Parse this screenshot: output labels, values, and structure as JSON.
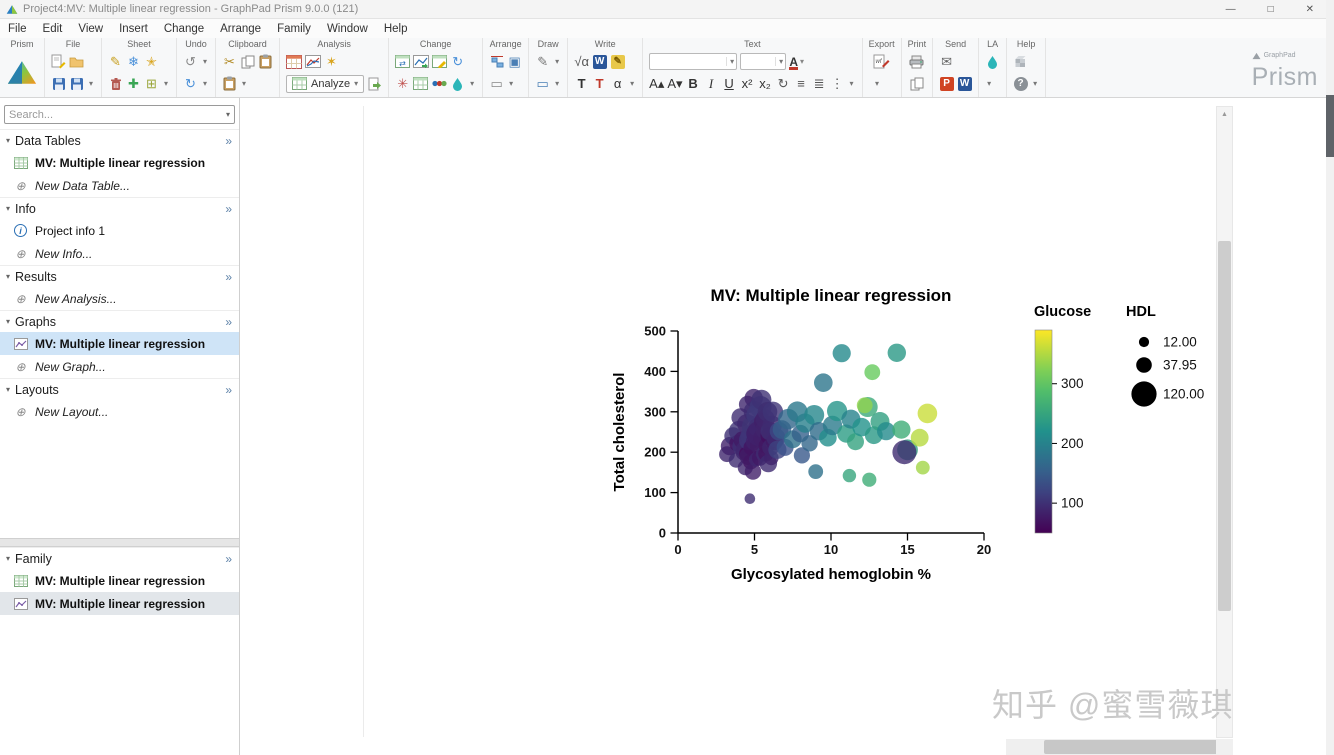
{
  "window": {
    "title": "Project4:MV: Multiple linear regression - GraphPad Prism 9.0.0 (121)",
    "controls": {
      "minimize": "—",
      "maximize": "□",
      "close": "✕"
    }
  },
  "menu": {
    "items": [
      "File",
      "Edit",
      "View",
      "Insert",
      "Change",
      "Arrange",
      "Family",
      "Window",
      "Help"
    ]
  },
  "toolbar": {
    "brand": {
      "name": "Prism",
      "sub": "GraphPad"
    },
    "groups": [
      {
        "label": "Prism",
        "name": "prism",
        "rows": [
          [
            {
              "n": "prism-logo-icon",
              "k": "prism"
            }
          ]
        ]
      },
      {
        "label": "File",
        "name": "file",
        "rows": [
          [
            {
              "n": "new-file-icon",
              "k": "docpencil"
            },
            {
              "n": "open-file-icon",
              "k": "folder"
            }
          ],
          [
            {
              "n": "save-icon",
              "k": "disk"
            },
            {
              "n": "save-as-icon",
              "k": "disk"
            },
            {
              "n": "file-menu-icon",
              "g": "▾"
            }
          ]
        ]
      },
      {
        "label": "Sheet",
        "name": "sheet",
        "rows": [
          [
            {
              "n": "rename-sheet-icon",
              "g": "✎",
              "c": "#c8a020"
            },
            {
              "n": "freeze-sheet-icon",
              "g": "❄",
              "c": "#4a90d9"
            },
            {
              "n": "star-sheet-icon",
              "g": "✭",
              "c": "#d9a520"
            }
          ],
          [
            {
              "n": "delete-sheet-icon",
              "k": "trash"
            },
            {
              "n": "new-sheet-icon",
              "g": "✚",
              "c": "#3aa655"
            },
            {
              "n": "exclude-sheet-icon",
              "g": "⊞",
              "c": "#9aa63a"
            },
            {
              "n": "sheet-menu-icon",
              "g": "▾"
            }
          ]
        ]
      },
      {
        "label": "Undo",
        "name": "undo",
        "rows": [
          [
            {
              "n": "undo-icon",
              "g": "↺",
              "c": "#8a8a8a"
            },
            {
              "n": "undo-menu-icon",
              "g": "▾"
            }
          ],
          [
            {
              "n": "redo-icon",
              "g": "↻",
              "c": "#4a90d9"
            },
            {
              "n": "redo-menu-icon",
              "g": "▾"
            }
          ]
        ]
      },
      {
        "label": "Clipboard",
        "name": "clipboard",
        "rows": [
          [
            {
              "n": "cut-icon",
              "g": "✂",
              "c": "#b08820"
            },
            {
              "n": "copy-icon",
              "k": "copy"
            },
            {
              "n": "paste-icon",
              "k": "clipboard"
            }
          ],
          [
            {
              "n": "paste-special-icon",
              "k": "clipboard"
            },
            {
              "n": "clipboard-menu-icon",
              "g": "▾"
            }
          ]
        ]
      },
      {
        "label": "Analysis",
        "name": "analysis",
        "rows": [
          [
            {
              "n": "new-analysis-table-icon",
              "k": "tableOrange"
            },
            {
              "n": "xy-analysis-icon",
              "k": "chart"
            },
            {
              "n": "wand-icon",
              "g": "✶",
              "c": "#d9a520"
            }
          ],
          [
            {
              "n": "analyze-button",
              "k": "analyze",
              "label": "Analyze"
            },
            {
              "n": "apply-analysis-icon",
              "k": "docarrow"
            }
          ]
        ]
      },
      {
        "label": "Change",
        "name": "change",
        "rows": [
          [
            {
              "n": "swap-rows-icon",
              "k": "tableSwap"
            },
            {
              "n": "change-graph-type-icon",
              "k": "chartChange"
            },
            {
              "n": "edit-table-icon",
              "k": "tablePencil"
            },
            {
              "n": "update-icon",
              "g": "↻",
              "c": "#4a90d9"
            }
          ],
          [
            {
              "n": "interpolate-icon",
              "g": "✳",
              "c": "#c0504d"
            },
            {
              "n": "transpose-icon",
              "k": "tableGreen"
            },
            {
              "n": "symbols-icon",
              "k": "dots"
            },
            {
              "n": "color-scheme-icon",
              "k": "paint"
            },
            {
              "n": "change-menu-icon",
              "g": "▾"
            }
          ]
        ]
      },
      {
        "label": "Arrange",
        "name": "arrange",
        "rows": [
          [
            {
              "n": "align-objects-icon",
              "k": "align"
            },
            {
              "n": "group-objects-icon",
              "g": "▣",
              "c": "#4a7fb5"
            }
          ],
          [
            {
              "n": "send-back-icon",
              "g": "▭",
              "c": "#888"
            },
            {
              "n": "arrange-menu-icon",
              "g": "▾"
            }
          ]
        ]
      },
      {
        "label": "Draw",
        "name": "draw",
        "rows": [
          [
            {
              "n": "draw-tool-icon",
              "g": "✎",
              "c": "#777"
            },
            {
              "n": "draw-menu-icon",
              "g": "▾"
            }
          ],
          [
            {
              "n": "shape-tool-icon",
              "g": "▭",
              "c": "#4a7fb5"
            },
            {
              "n": "shape-menu-icon",
              "g": "▾"
            }
          ]
        ]
      },
      {
        "label": "Write",
        "name": "write",
        "rows": [
          [
            {
              "n": "equation-icon",
              "g": "√α",
              "c": "#555"
            },
            {
              "n": "word-export-icon",
              "k": "word"
            },
            {
              "n": "note-icon",
              "k": "note"
            }
          ],
          [
            {
              "n": "text-tool-icon",
              "g": "T",
              "c": "#333",
              "cls": "b"
            },
            {
              "n": "text-box-icon",
              "g": "T",
              "c": "#c0392b",
              "cls": "b"
            },
            {
              "n": "greek-icon",
              "g": "α",
              "c": "#333"
            },
            {
              "n": "write-menu-icon",
              "g": "▾"
            }
          ]
        ]
      },
      {
        "label": "Text",
        "name": "text",
        "rows": [
          [
            {
              "n": "font-family-select",
              "k": "combo",
              "w": 88
            },
            {
              "n": "font-size-select",
              "k": "combo",
              "w": 46
            },
            {
              "n": "font-color-button",
              "k": "colorA"
            }
          ],
          [
            {
              "n": "increase-font-button",
              "g": "A▴",
              "c": "#333"
            },
            {
              "n": "decrease-font-button",
              "g": "A▾",
              "c": "#333"
            },
            {
              "n": "bold-button",
              "g": "B",
              "c": "#333",
              "cls": "b"
            },
            {
              "n": "italic-button",
              "g": "I",
              "c": "#333",
              "cls": "i"
            },
            {
              "n": "underline-button",
              "g": "U",
              "c": "#333",
              "cls": "u"
            },
            {
              "n": "superscript-button",
              "g": "x²",
              "c": "#333"
            },
            {
              "n": "subscript-button",
              "g": "x₂",
              "c": "#333"
            },
            {
              "n": "rotate-text-button",
              "g": "↻",
              "c": "#555"
            },
            {
              "n": "align-text-button",
              "g": "≡",
              "c": "#555"
            },
            {
              "n": "line-spacing-button",
              "g": "≣",
              "c": "#555"
            },
            {
              "n": "list-button",
              "g": "⋮",
              "c": "#555"
            },
            {
              "n": "text-menu-icon",
              "g": "▾"
            }
          ]
        ]
      },
      {
        "label": "Export",
        "name": "export",
        "rows": [
          [
            {
              "n": "export-icon",
              "k": "export"
            }
          ],
          [
            {
              "n": "export-menu-icon",
              "g": "▾"
            }
          ]
        ]
      },
      {
        "label": "Print",
        "name": "print",
        "rows": [
          [
            {
              "n": "print-icon",
              "k": "printer"
            }
          ],
          [
            {
              "n": "copy-graph-icon",
              "k": "copy"
            }
          ]
        ]
      },
      {
        "label": "Send",
        "name": "send",
        "rows": [
          [
            {
              "n": "email-icon",
              "g": "✉",
              "c": "#666"
            }
          ],
          [
            {
              "n": "powerpoint-icon",
              "k": "ppt"
            },
            {
              "n": "word-icon",
              "k": "word"
            }
          ]
        ]
      },
      {
        "label": "LA",
        "name": "la",
        "rows": [
          [
            {
              "n": "labarchives-icon",
              "k": "paint"
            }
          ],
          [
            {
              "n": "la-menu-icon",
              "g": "▾"
            }
          ]
        ]
      },
      {
        "label": "Help",
        "name": "help",
        "rows": [
          [
            {
              "n": "prism-academy-icon",
              "k": "cube"
            }
          ],
          [
            {
              "n": "help-icon",
              "k": "help"
            },
            {
              "n": "help-menu-icon",
              "g": "▾"
            }
          ]
        ]
      }
    ]
  },
  "sidebar": {
    "search": {
      "placeholder": "Search..."
    },
    "sections": [
      {
        "label": "Data Tables",
        "items": [
          {
            "label": "MV: Multiple linear regression",
            "icon": "table",
            "bold": true
          },
          {
            "label": "New Data Table...",
            "icon": "plus",
            "italic": true
          }
        ]
      },
      {
        "label": "Info",
        "items": [
          {
            "label": "Project info 1",
            "icon": "info"
          },
          {
            "label": "New Info...",
            "icon": "plus",
            "italic": true
          }
        ]
      },
      {
        "label": "Results",
        "items": [
          {
            "label": "New Analysis...",
            "icon": "plus",
            "italic": true
          }
        ]
      },
      {
        "label": "Graphs",
        "items": [
          {
            "label": "MV: Multiple linear regression",
            "icon": "graph",
            "bold": true,
            "selected": true
          },
          {
            "label": "New Graph...",
            "icon": "plus",
            "italic": true
          }
        ]
      },
      {
        "label": "Layouts",
        "items": [
          {
            "label": "New Layout...",
            "icon": "plus",
            "italic": true
          }
        ]
      }
    ],
    "family": {
      "label": "Family",
      "items": [
        {
          "label": "MV: Multiple linear regression",
          "icon": "table",
          "bold": true
        },
        {
          "label": "MV: Multiple linear regression",
          "icon": "graph",
          "bold": true,
          "selected2": true
        }
      ]
    }
  },
  "chart_data": {
    "type": "bubble",
    "title": "MV: Multiple linear regression",
    "xlabel": "Glycosylated hemoglobin %",
    "ylabel": "Total cholesterol",
    "xlim": [
      0,
      20
    ],
    "ylim": [
      0,
      500
    ],
    "x_ticks": [
      0,
      5,
      10,
      15,
      20
    ],
    "y_ticks": [
      0,
      100,
      200,
      300,
      400,
      500
    ],
    "colorbar": {
      "title": "Glucose",
      "ticks": [
        100,
        200,
        300
      ],
      "range": [
        50,
        390
      ],
      "colormap": "viridis"
    },
    "size_legend": {
      "title": "HDL",
      "entries": [
        {
          "value": "12.00",
          "hdl": 12
        },
        {
          "value": "37.95",
          "hdl": 37.95
        },
        {
          "value": "120.00",
          "hdl": 120
        }
      ]
    },
    "points_format": [
      "glycosylated_hemoglobin_x",
      "total_cholesterol_y",
      "glucose_color",
      "hdl_size"
    ],
    "points": [
      [
        3.2,
        195,
        90,
        40
      ],
      [
        3.4,
        215,
        84,
        58
      ],
      [
        3.6,
        240,
        100,
        52
      ],
      [
        3.8,
        180,
        95,
        34
      ],
      [
        3.9,
        222,
        70,
        46
      ],
      [
        4.0,
        252,
        102,
        78
      ],
      [
        4.1,
        286,
        96,
        60
      ],
      [
        4.15,
        214,
        99,
        58
      ],
      [
        4.2,
        230,
        76,
        50
      ],
      [
        4.3,
        200,
        88,
        44
      ],
      [
        4.35,
        206,
        91,
        52
      ],
      [
        4.4,
        162,
        90,
        36
      ],
      [
        4.45,
        196,
        64,
        30
      ],
      [
        4.5,
        270,
        92,
        68
      ],
      [
        4.55,
        318,
        90,
        50
      ],
      [
        4.6,
        190,
        80,
        54
      ],
      [
        4.65,
        230,
        107,
        72
      ],
      [
        4.7,
        85,
        96,
        14
      ],
      [
        4.7,
        240,
        105,
        64
      ],
      [
        4.75,
        176,
        73,
        36
      ],
      [
        4.8,
        212,
        70,
        40
      ],
      [
        4.85,
        264,
        103,
        76
      ],
      [
        4.9,
        152,
        82,
        44
      ],
      [
        4.95,
        334,
        86,
        58
      ],
      [
        5.0,
        300,
        95,
        84
      ],
      [
        5.0,
        226,
        85,
        50
      ],
      [
        5.05,
        246,
        84,
        56
      ],
      [
        5.1,
        182,
        90,
        30
      ],
      [
        5.15,
        292,
        108,
        80
      ],
      [
        5.2,
        262,
        100,
        60
      ],
      [
        5.25,
        216,
        79,
        46
      ],
      [
        5.3,
        246,
        85,
        118
      ],
      [
        5.35,
        186,
        74,
        40
      ],
      [
        5.4,
        312,
        110,
        88
      ],
      [
        5.45,
        330,
        100,
        70
      ],
      [
        5.5,
        236,
        82,
        54
      ],
      [
        5.55,
        276,
        81,
        54
      ],
      [
        5.6,
        196,
        95,
        38
      ],
      [
        5.65,
        256,
        87,
        58
      ],
      [
        5.7,
        282,
        88,
        66
      ],
      [
        5.75,
        196,
        71,
        38
      ],
      [
        5.8,
        216,
        72,
        42
      ],
      [
        5.85,
        300,
        97,
        68
      ],
      [
        5.9,
        172,
        94,
        52
      ],
      [
        5.95,
        240,
        66,
        48
      ],
      [
        6.0,
        252,
        98,
        58
      ],
      [
        6.05,
        212,
        89,
        48
      ],
      [
        6.1,
        186,
        86,
        32
      ],
      [
        6.15,
        266,
        94,
        66
      ],
      [
        6.2,
        300,
        104,
        74
      ],
      [
        6.3,
        226,
        76,
        48
      ],
      [
        6.4,
        236,
        93,
        62
      ],
      [
        6.5,
        206,
        118,
        56
      ],
      [
        6.6,
        252,
        125,
        60
      ],
      [
        6.8,
        256,
        148,
        60
      ],
      [
        7.0,
        212,
        136,
        48
      ],
      [
        7.2,
        282,
        164,
        74
      ],
      [
        7.5,
        232,
        176,
        54
      ],
      [
        7.8,
        300,
        186,
        78
      ],
      [
        8.0,
        246,
        154,
        50
      ],
      [
        8.1,
        192,
        144,
        42
      ],
      [
        8.3,
        272,
        196,
        64
      ],
      [
        8.6,
        222,
        162,
        44
      ],
      [
        8.9,
        292,
        206,
        70
      ],
      [
        9.0,
        152,
        176,
        34
      ],
      [
        9.2,
        252,
        170,
        58
      ],
      [
        9.5,
        372,
        182,
        60
      ],
      [
        9.8,
        236,
        216,
        52
      ],
      [
        10.1,
        266,
        190,
        66
      ],
      [
        10.4,
        302,
        226,
        72
      ],
      [
        10.7,
        445,
        210,
        56
      ],
      [
        11.0,
        246,
        236,
        56
      ],
      [
        11.2,
        142,
        250,
        26
      ],
      [
        11.3,
        282,
        200,
        62
      ],
      [
        11.6,
        226,
        246,
        48
      ],
      [
        12.0,
        262,
        222,
        60
      ],
      [
        12.4,
        312,
        256,
        70
      ],
      [
        12.5,
        132,
        262,
        30
      ],
      [
        12.7,
        398,
        310,
        40
      ],
      [
        12.8,
        242,
        232,
        54
      ],
      [
        13.2,
        276,
        242,
        62
      ],
      [
        13.6,
        252,
        212,
        56
      ],
      [
        14.3,
        446,
        232,
        58
      ],
      [
        14.6,
        256,
        262,
        56
      ],
      [
        15.0,
        206,
        248,
        78
      ],
      [
        12.2,
        316,
        332,
        40
      ],
      [
        15.8,
        236,
        352,
        54
      ],
      [
        16.3,
        296,
        362,
        68
      ],
      [
        16.0,
        162,
        342,
        28
      ],
      [
        14.8,
        200,
        95,
        108
      ]
    ]
  },
  "watermark": {
    "text": "知乎 @蜜雪薇琪"
  }
}
